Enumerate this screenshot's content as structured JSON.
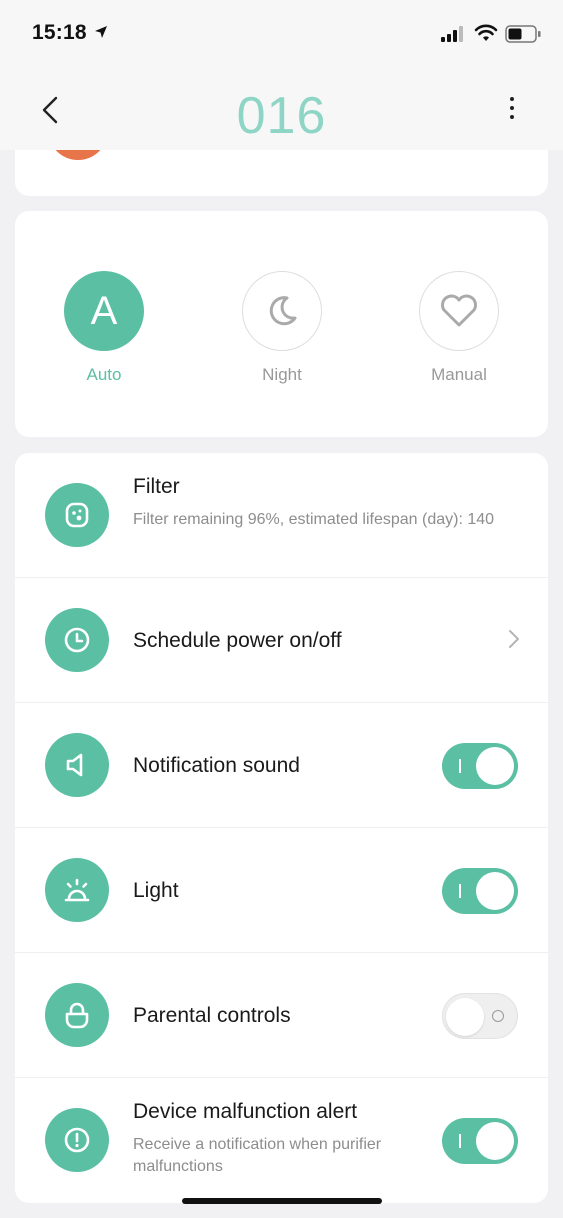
{
  "status_bar": {
    "time": "15:18"
  },
  "header": {
    "title": "016"
  },
  "modes": [
    {
      "label": "Auto",
      "letter": "A",
      "icon": "auto-letter-icon",
      "active": true
    },
    {
      "label": "Night",
      "icon": "moon-icon",
      "active": false
    },
    {
      "label": "Manual",
      "icon": "heart-icon",
      "active": false
    }
  ],
  "settings": {
    "filter": {
      "title": "Filter",
      "subtitle": "Filter remaining 96%,  estimated lifespan (day): 140",
      "icon": "filter-icon"
    },
    "schedule": {
      "title": "Schedule power on/off",
      "icon": "clock-icon"
    },
    "notification_sound": {
      "title": "Notification sound",
      "icon": "speaker-icon",
      "enabled": true
    },
    "light": {
      "title": "Light",
      "icon": "light-icon",
      "enabled": true
    },
    "parental_controls": {
      "title": "Parental controls",
      "icon": "lock-icon",
      "enabled": false
    },
    "malfunction_alert": {
      "title": "Device malfunction alert",
      "subtitle": "Receive a notification when purifier malfunctions",
      "icon": "alert-icon",
      "enabled": true
    }
  },
  "colors": {
    "accent": "#5bbfa4",
    "title_accent": "#8ed5c6",
    "orange": "#e8744a"
  }
}
